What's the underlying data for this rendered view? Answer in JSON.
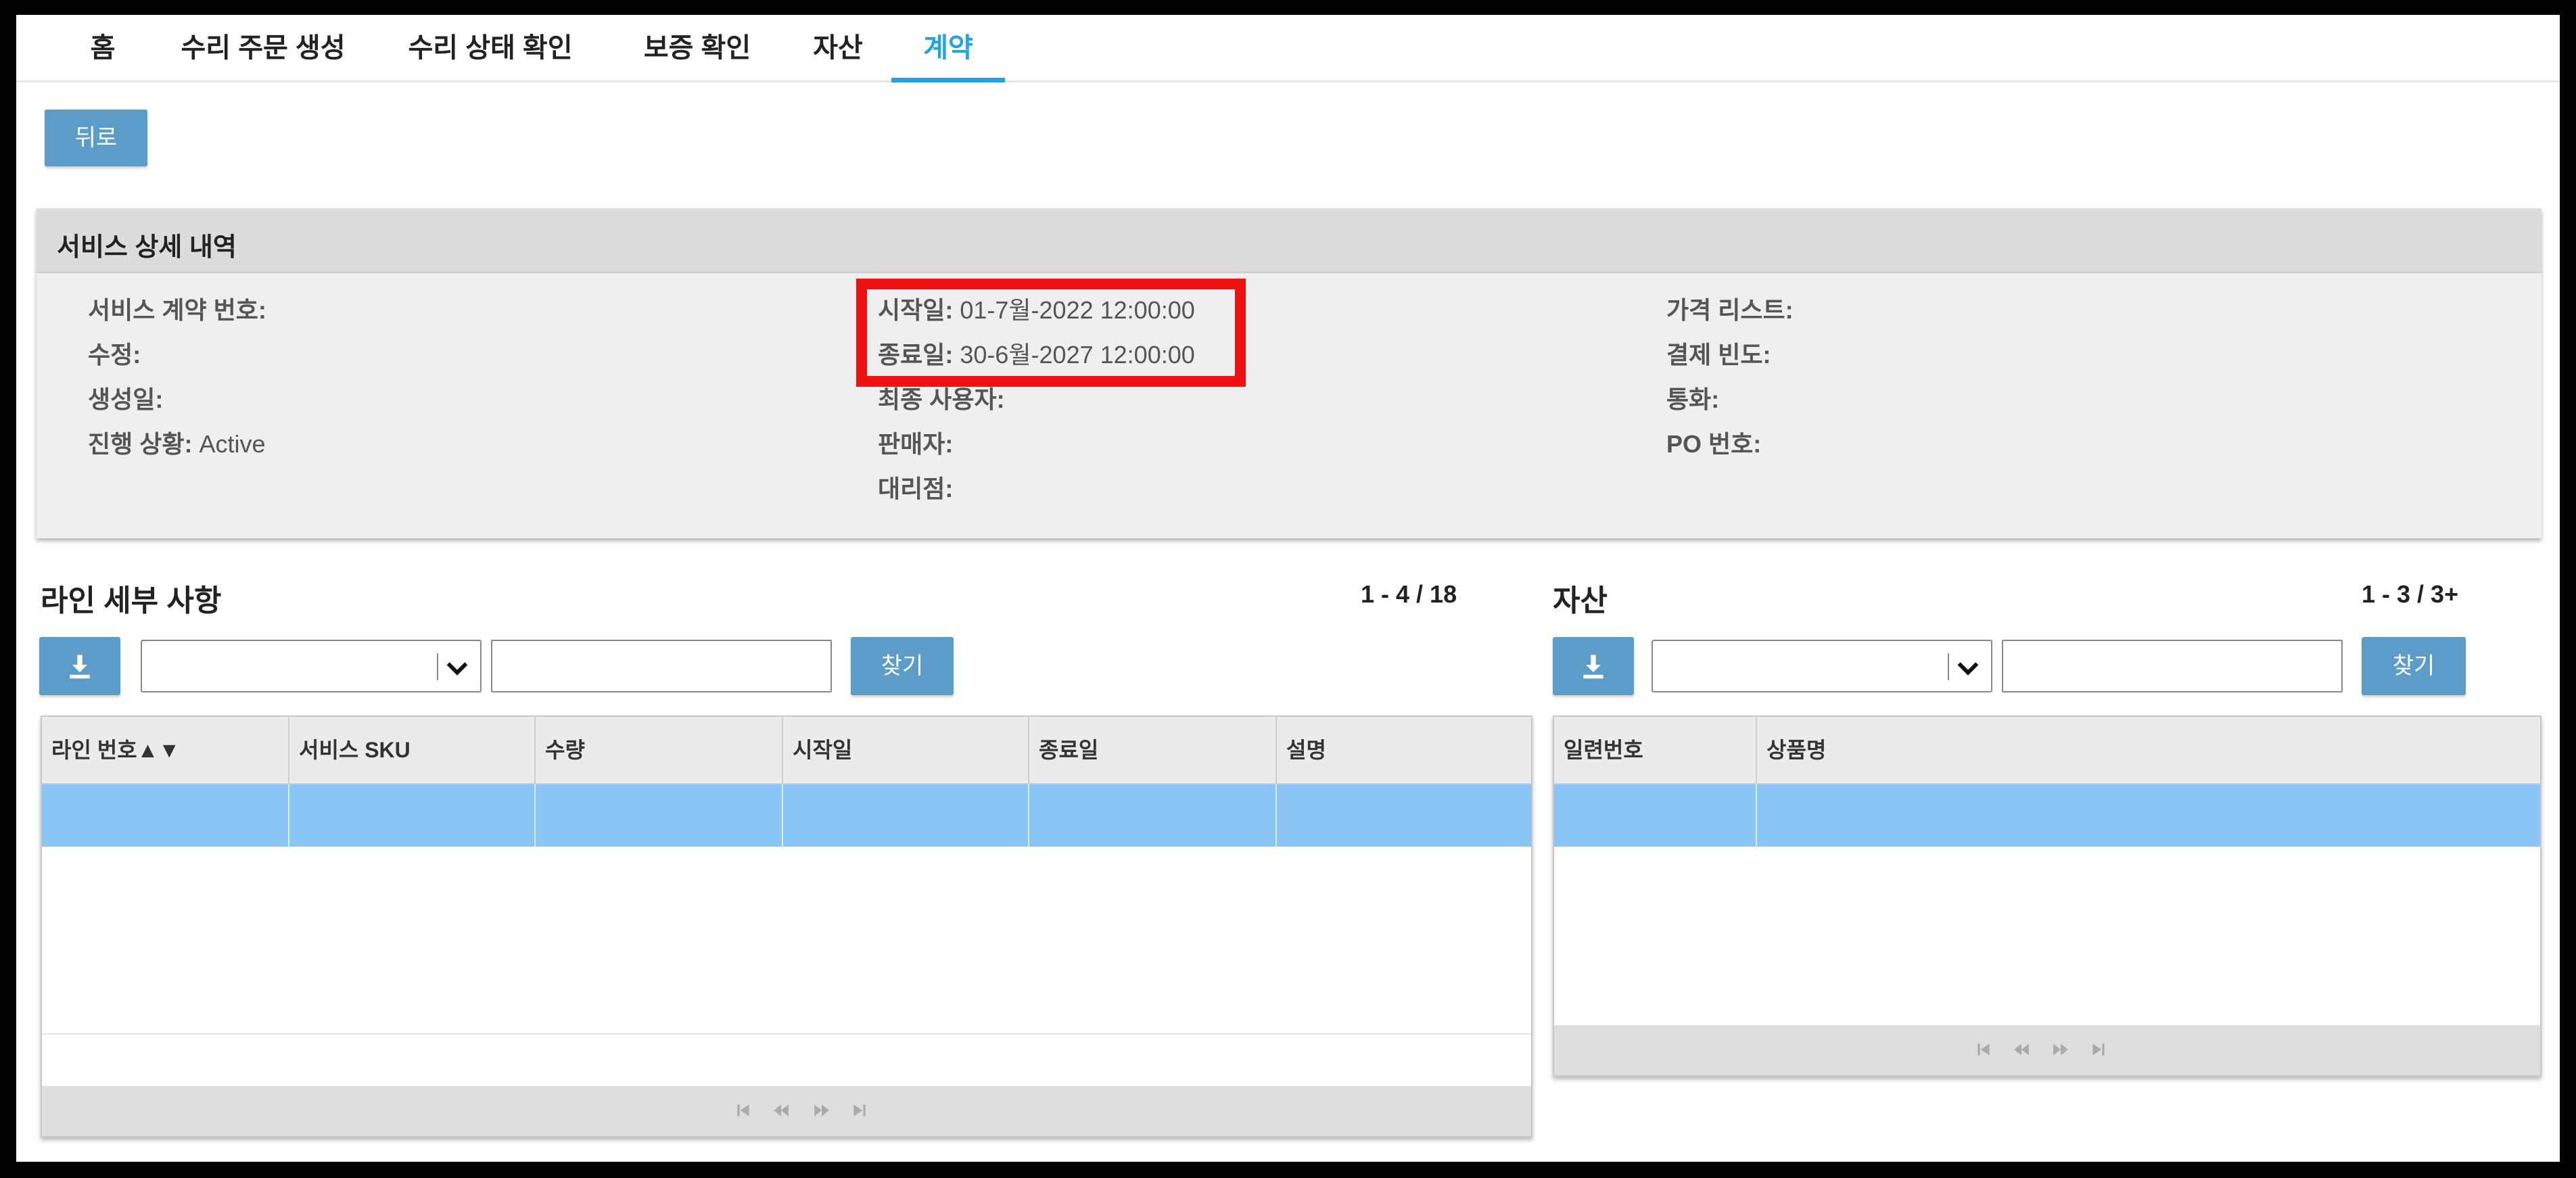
{
  "nav": {
    "tabs": [
      {
        "label": "홈"
      },
      {
        "label": "수리 주문 생성"
      },
      {
        "label": "수리 상태 확인"
      },
      {
        "label": "보증 확인"
      },
      {
        "label": "자산"
      },
      {
        "label": "계약"
      }
    ],
    "active_tab": "계약"
  },
  "back_button": {
    "label": "뒤로"
  },
  "service_details": {
    "title": "서비스 상세 내역",
    "contract_number": {
      "label": "서비스 계약 번호:",
      "value": ""
    },
    "revision": {
      "label": "수정:",
      "value": ""
    },
    "created_date": {
      "label": "생성일:",
      "value": ""
    },
    "status": {
      "label": "진행 상황:",
      "value": "Active"
    },
    "start_date": {
      "label": "시작일:",
      "value": "01-7월-2022 12:00:00"
    },
    "end_date": {
      "label": "종료일:",
      "value": "30-6월-2027 12:00:00"
    },
    "end_user": {
      "label": "최종 사용자:",
      "value": ""
    },
    "seller": {
      "label": "판매자:",
      "value": ""
    },
    "reseller": {
      "label": "대리점:",
      "value": ""
    },
    "price_list": {
      "label": "가격 리스트:",
      "value": ""
    },
    "billing_frequency": {
      "label": "결제 빈도:",
      "value": ""
    },
    "currency": {
      "label": "통화:",
      "value": ""
    },
    "po_number": {
      "label": "PO 번호:",
      "value": ""
    }
  },
  "line_details": {
    "title": "라인 세부 사항",
    "counter": "1 - 4 / 18",
    "search_button": "찾기",
    "select_value": "",
    "search_value": "",
    "columns": [
      "라인 번호▲▼",
      "서비스 SKU",
      "수량",
      "시작일",
      "종료일",
      "설명"
    ]
  },
  "assets": {
    "title": "자산",
    "counter": "1 - 3 / 3+",
    "search_button": "찾기",
    "select_value": "",
    "search_value": "",
    "columns": [
      "일련번호",
      "상품명"
    ]
  },
  "colors": {
    "accent": "#20a3e8",
    "button": "#5b9cc9",
    "selected_row": "#8ac5f5",
    "highlight_box": "#ee1111"
  },
  "icons": [
    "download-icon",
    "chevron-down-icon",
    "first-page-icon",
    "prev-page-icon",
    "next-page-icon",
    "last-page-icon"
  ]
}
